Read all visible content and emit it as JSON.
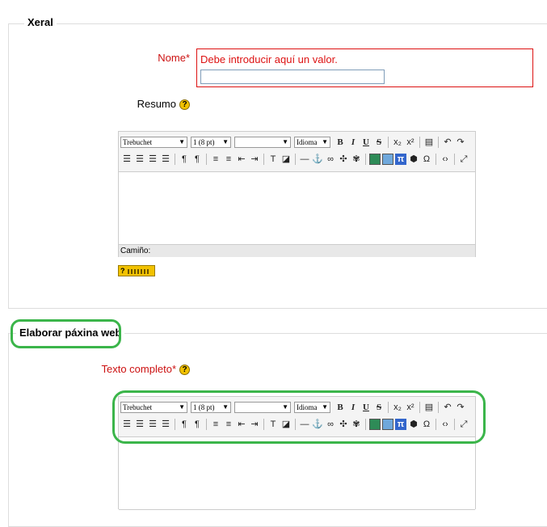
{
  "section_general": {
    "legend": "Xeral"
  },
  "name_field": {
    "label": "Nome",
    "required_mark": "*",
    "error": "Debe introducir aquí un valor.",
    "value": ""
  },
  "summary_field": {
    "label": "Resumo",
    "help": "?"
  },
  "editor": {
    "font_family": "Trebuchet",
    "font_size": "1 (8 pt)",
    "format": "",
    "language": "Idioma",
    "path_label": "Camiño:"
  },
  "section_web": {
    "legend": "Elaborar páxina web"
  },
  "full_text_field": {
    "label": "Texto completo",
    "required_mark": "*",
    "help": "?"
  },
  "keyboard_help": {
    "label": "?"
  },
  "colors": {
    "error": "#dd1111",
    "highlight": "#3bb54a",
    "help": "#f2c200"
  }
}
